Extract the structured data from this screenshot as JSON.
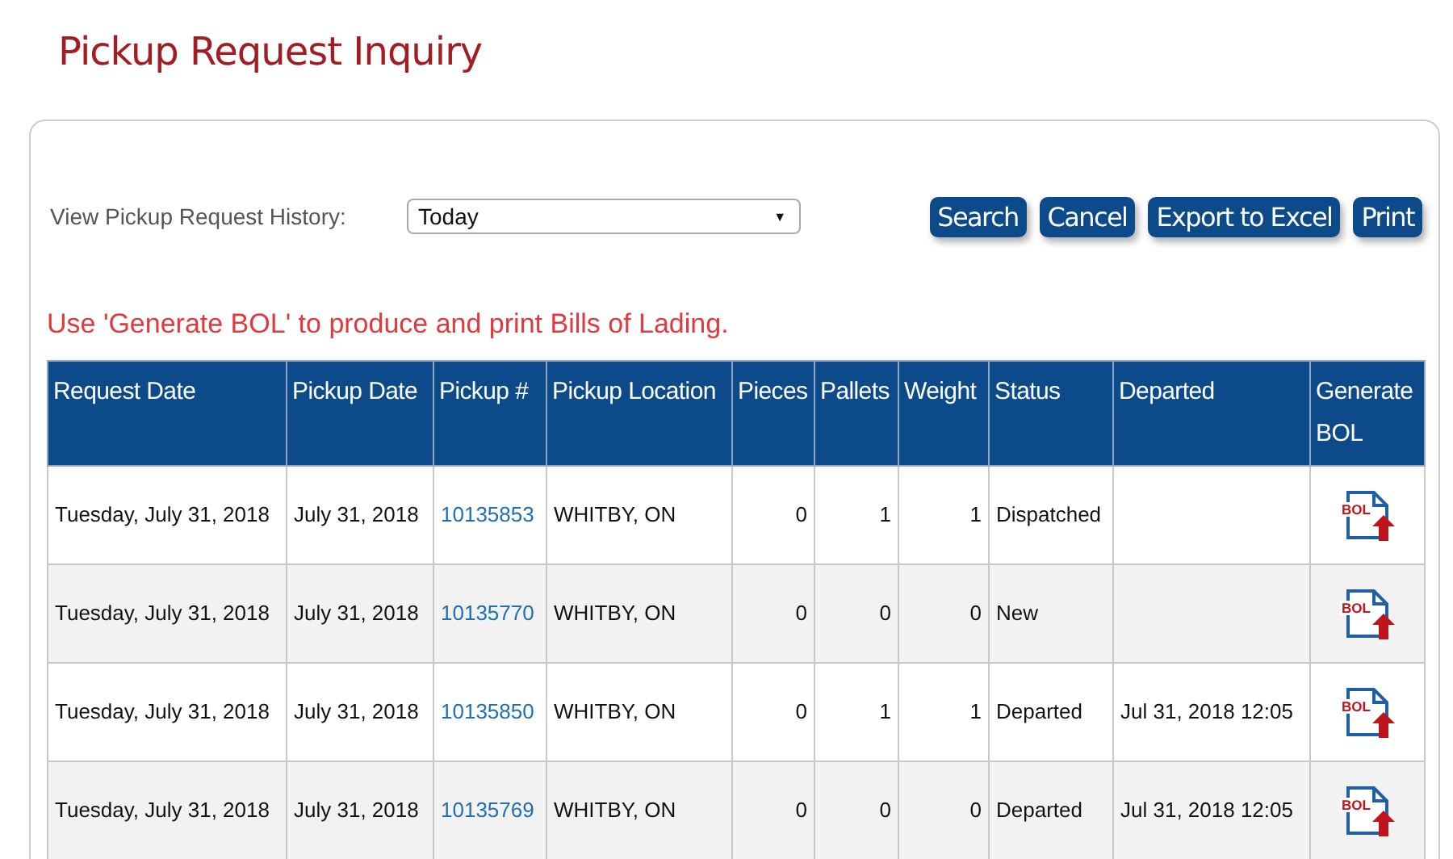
{
  "title": "Pickup Request Inquiry",
  "history": {
    "label": "View Pickup Request History:",
    "value": "Today",
    "arrow": "▼"
  },
  "buttons": [
    "Search",
    "Cancel",
    "Export to Excel",
    "Print"
  ],
  "message": "Use 'Generate BOL' to produce and print Bills of Lading.",
  "table": {
    "columns": [
      "Request Date",
      "Pickup Date",
      "Pickup #",
      "Pickup Location",
      "Pieces",
      "Pallets",
      "Weight",
      "Status",
      "Departed",
      "Generate BOL"
    ],
    "rows": [
      {
        "request_date": "Tuesday, July 31, 2018",
        "pickup_date": "July 31, 2018",
        "pickup_no": "10135853",
        "location": "WHITBY, ON",
        "pieces": "0",
        "pallets": "1",
        "weight": "1",
        "status": "Dispatched",
        "departed": "",
        "bol_label": "BOL"
      },
      {
        "request_date": "Tuesday, July 31, 2018",
        "pickup_date": "July 31, 2018",
        "pickup_no": "10135770",
        "location": "WHITBY, ON",
        "pieces": "0",
        "pallets": "0",
        "weight": "0",
        "status": "New",
        "departed": "",
        "bol_label": "BOL"
      },
      {
        "request_date": "Tuesday, July 31, 2018",
        "pickup_date": "July 31, 2018",
        "pickup_no": "10135850",
        "location": "WHITBY, ON",
        "pieces": "0",
        "pallets": "1",
        "weight": "1",
        "status": "Departed",
        "departed": "Jul 31, 2018 12:05",
        "bol_label": "BOL"
      },
      {
        "request_date": "Tuesday, July 31, 2018",
        "pickup_date": "July 31, 2018",
        "pickup_no": "10135769",
        "location": "WHITBY, ON",
        "pieces": "0",
        "pallets": "0",
        "weight": "0",
        "status": "Departed",
        "departed": "Jul 31, 2018 12:05",
        "bol_label": "BOL"
      }
    ]
  }
}
